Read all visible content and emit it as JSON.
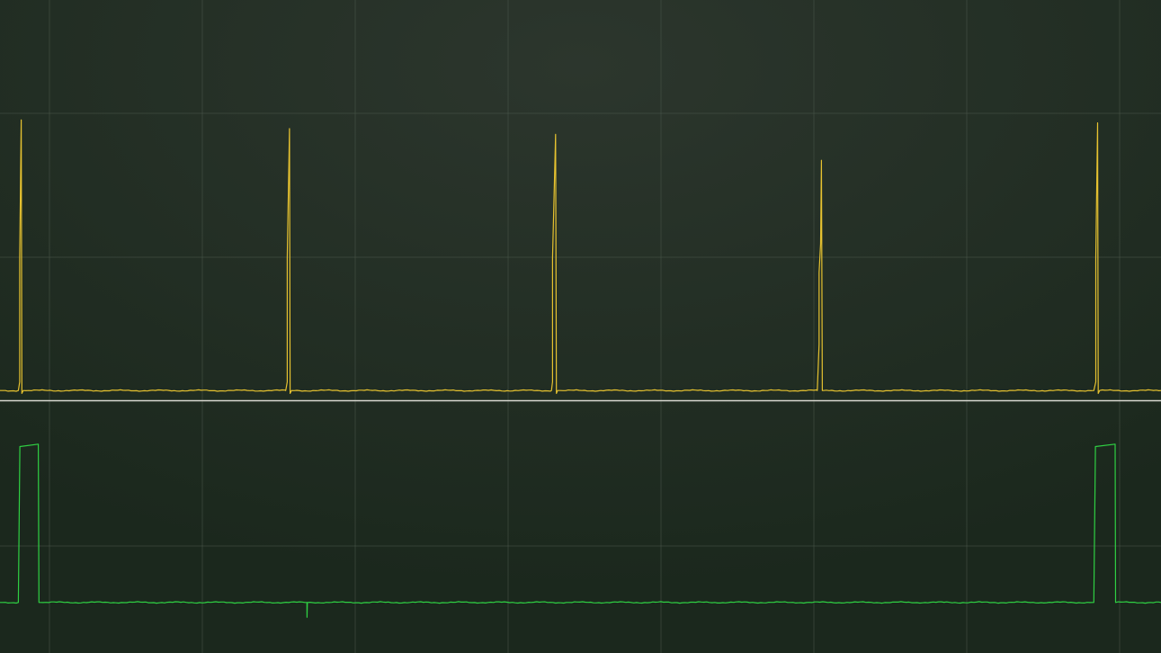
{
  "chart_data": {
    "type": "line",
    "title": "",
    "xlabel": "",
    "ylabel": "",
    "grid": true,
    "legend": "none",
    "colors": {
      "background": "#1b281d",
      "background_center": "#2c362d",
      "grid": "#4a564a",
      "separator": "#d8d8d0",
      "ch1": "#e6c230",
      "ch2": "#2fd043"
    },
    "x_divisions": 7.6,
    "x_offset_divisions": 0.32,
    "channels": [
      {
        "name": "",
        "color_key": "ch1",
        "ylim": [
          0,
          1
        ],
        "points": [
          [
            0.0,
            0.04
          ],
          [
            0.12,
            0.04
          ],
          [
            0.129,
            0.07
          ],
          [
            0.129,
            0.5
          ],
          [
            0.139,
            0.98
          ],
          [
            0.143,
            0.03
          ],
          [
            0.152,
            0.04
          ],
          [
            1.87,
            0.04
          ],
          [
            1.88,
            0.07
          ],
          [
            1.88,
            0.5
          ],
          [
            1.895,
            0.95
          ],
          [
            1.899,
            0.03
          ],
          [
            1.908,
            0.04
          ],
          [
            3.61,
            0.04
          ],
          [
            3.617,
            0.07
          ],
          [
            3.617,
            0.5
          ],
          [
            3.637,
            0.93
          ],
          [
            3.642,
            0.03
          ],
          [
            3.65,
            0.04
          ],
          [
            5.35,
            0.04
          ],
          [
            5.362,
            0.2
          ],
          [
            5.362,
            0.45
          ],
          [
            5.372,
            0.55
          ],
          [
            5.377,
            0.84
          ],
          [
            5.383,
            0.04
          ],
          [
            5.392,
            0.04
          ],
          [
            7.16,
            0.04
          ],
          [
            7.173,
            0.07
          ],
          [
            7.173,
            0.5
          ],
          [
            7.185,
            0.97
          ],
          [
            7.189,
            0.03
          ],
          [
            7.198,
            0.04
          ],
          [
            7.6,
            0.04
          ]
        ]
      },
      {
        "name": "",
        "color_key": "ch2",
        "ylim": [
          0,
          1
        ],
        "points": [
          [
            0.0,
            0.19
          ],
          [
            0.12,
            0.19
          ],
          [
            0.13,
            0.82
          ],
          [
            0.251,
            0.83
          ],
          [
            0.255,
            0.19
          ],
          [
            0.265,
            0.19
          ],
          [
            2.009,
            0.19
          ],
          [
            2.01,
            0.13
          ],
          [
            2.012,
            0.19
          ],
          [
            7.16,
            0.19
          ],
          [
            7.171,
            0.82
          ],
          [
            7.3,
            0.83
          ],
          [
            7.303,
            0.19
          ],
          [
            7.6,
            0.19
          ]
        ]
      }
    ]
  }
}
